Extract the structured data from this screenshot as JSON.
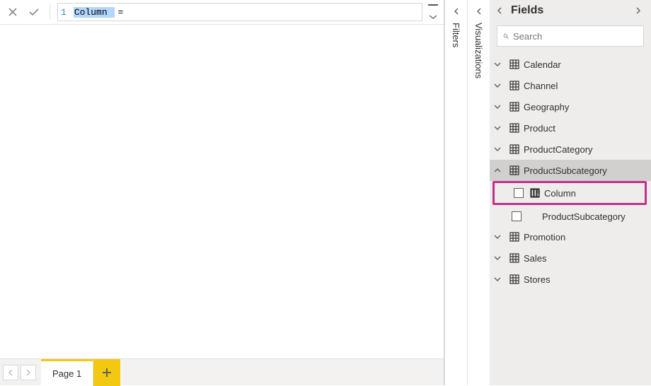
{
  "formula": {
    "line_number": "1",
    "highlighted_token": "Column",
    "suffix": "="
  },
  "collapsed_panes": {
    "filters_label": "Filters",
    "visualizations_label": "Visualizations"
  },
  "fields_pane": {
    "title": "Fields",
    "search_placeholder": "Search",
    "tables": [
      {
        "name": "Calendar",
        "expanded": false
      },
      {
        "name": "Channel",
        "expanded": false
      },
      {
        "name": "Geography",
        "expanded": false
      },
      {
        "name": "Product",
        "expanded": false
      },
      {
        "name": "ProductCategory",
        "expanded": false
      },
      {
        "name": "ProductSubcategory",
        "expanded": true,
        "children": [
          {
            "name": "Column",
            "is_calc_column": true,
            "highlighted": true
          },
          {
            "name": "ProductSubcategory",
            "is_calc_column": false,
            "highlighted": false
          }
        ]
      },
      {
        "name": "Promotion",
        "expanded": false
      },
      {
        "name": "Sales",
        "expanded": false
      },
      {
        "name": "Stores",
        "expanded": false
      }
    ]
  },
  "page_tabs": {
    "tabs": [
      {
        "label": "Page 1",
        "active": true
      }
    ]
  },
  "highlight_color": "#c2328a",
  "accent_color": "#f2c811"
}
